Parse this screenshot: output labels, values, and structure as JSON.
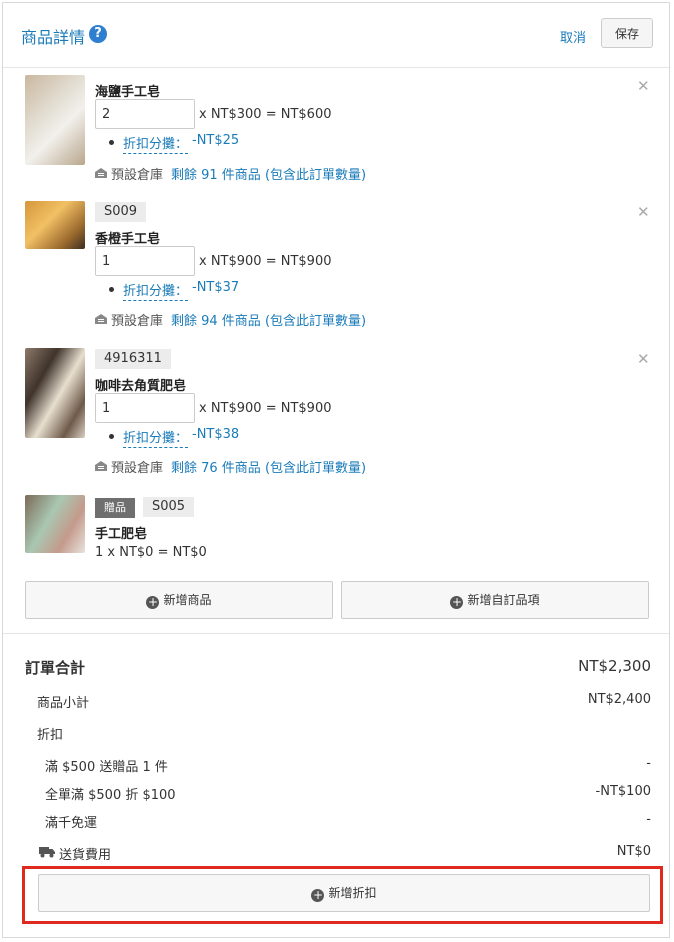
{
  "header": {
    "title": "商品詳情",
    "help_icon": "question-circle-icon",
    "cancel_label": "取消",
    "save_label": "保存"
  },
  "items": [
    {
      "name": "海鹽手工皂",
      "quantity": "2",
      "price_line": "x NT$300 = NT$600",
      "discount_label": "折扣分攤：",
      "discount_amount": "-NT$25",
      "warehouse_label": "預設倉庫",
      "stock_text": "剩餘 91 件商品 (包含此訂單數量)"
    },
    {
      "sku": "S009",
      "name": "香橙手工皂",
      "quantity": "1",
      "price_line": "x NT$900 = NT$900",
      "discount_label": "折扣分攤：",
      "discount_amount": "-NT$37",
      "warehouse_label": "預設倉庫",
      "stock_text": "剩餘 94 件商品 (包含此訂單數量)"
    },
    {
      "sku": "4916311",
      "name": "咖啡去角質肥皂",
      "quantity": "1",
      "price_line": "x NT$900 = NT$900",
      "discount_label": "折扣分攤：",
      "discount_amount": "-NT$38",
      "warehouse_label": "預設倉庫",
      "stock_text": "剩餘 76 件商品 (包含此訂單數量)"
    },
    {
      "badge": "贈品",
      "sku": "S005",
      "name": "手工肥皂",
      "price_line": "1 x NT$0 = NT$0"
    }
  ],
  "actions": {
    "add_product": "新增商品",
    "add_custom_item": "新增自訂品項",
    "add_discount": "新增折扣"
  },
  "summary": {
    "title": "訂單合計",
    "total": "NT$2,300",
    "subtotal_label": "商品小計",
    "subtotal_value": "NT$2,400",
    "discount_label": "折扣",
    "discounts": [
      {
        "label": "滿 $500 送贈品 1 件",
        "value": "-"
      },
      {
        "label": "全單滿 $500 折 $100",
        "value": "-NT$100"
      },
      {
        "label": "滿千免運",
        "value": "-"
      }
    ],
    "shipping_label": "送貨費用",
    "shipping_value": "NT$0"
  },
  "colors": {
    "link": "#1a7bb9",
    "highlight": "#e02a1f"
  }
}
